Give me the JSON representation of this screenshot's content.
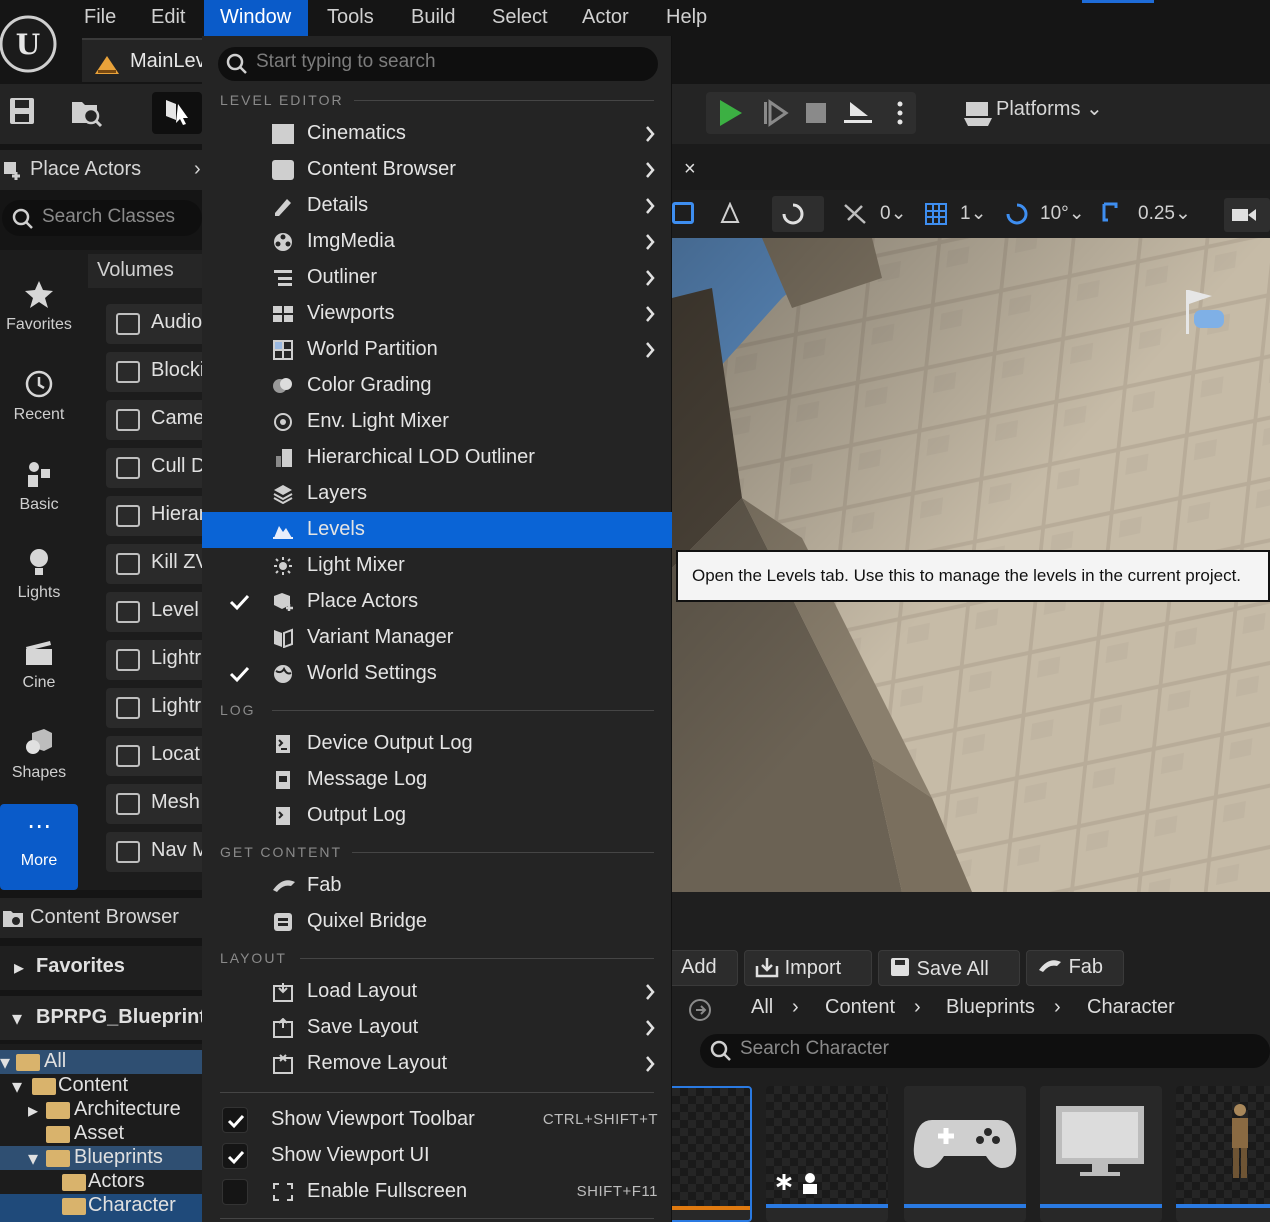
{
  "menu": {
    "items": [
      "File",
      "Edit",
      "Window",
      "Tools",
      "Build",
      "Select",
      "Actor",
      "Help"
    ],
    "active": "Window"
  },
  "level_tab": {
    "title": "MainLev"
  },
  "toolbar": {
    "platforms_label": "Platforms"
  },
  "place_actors": {
    "header": "Place Actors",
    "search_placeholder": "Search Classes",
    "categories": [
      "Favorites",
      "Recent",
      "Basic",
      "Lights",
      "Cine",
      "Shapes",
      "More"
    ],
    "section_title": "Volumes",
    "items": [
      "Audio",
      "Blocki",
      "Came",
      "Cull D",
      "Hierar",
      "Kill ZV",
      "Level",
      "Lightr",
      "Lightr",
      "Locat",
      "Mesh",
      "Nav M"
    ]
  },
  "content_browser_left": {
    "header": "Content Browser",
    "favorites": "Favorites",
    "project": "BPRPG_Blueprint",
    "tree": [
      "All",
      "Content",
      "Architecture",
      "Asset",
      "Blueprints",
      "Actors",
      "Character"
    ]
  },
  "viewport": {
    "snap_values": [
      "0",
      "1",
      "10°",
      "0.25"
    ],
    "close": "×",
    "tooltip": "Open the Levels tab. Use this to manage the levels in the current project."
  },
  "content_browser_right": {
    "buttons": [
      "Add",
      "Import",
      "Save All",
      "Fab"
    ],
    "breadcrumb": [
      "All",
      "Content",
      "Blueprints",
      "Character"
    ],
    "search_placeholder": "Search Character"
  },
  "window_menu": {
    "search_placeholder": "Start typing to search",
    "sections": {
      "level_editor": "LEVEL EDITOR",
      "log": "LOG",
      "get_content": "GET CONTENT",
      "layout": "LAYOUT"
    },
    "level_editor_items": [
      "Cinematics",
      "Content Browser",
      "Details",
      "ImgMedia",
      "Outliner",
      "Viewports",
      "World Partition",
      "Color Grading",
      "Env. Light Mixer",
      "Hierarchical LOD Outliner",
      "Layers",
      "Levels",
      "Light Mixer",
      "Place Actors",
      "Variant Manager",
      "World Settings"
    ],
    "log_items": [
      "Device Output Log",
      "Message Log",
      "Output Log"
    ],
    "get_content_items": [
      "Fab",
      "Quixel Bridge"
    ],
    "layout_items": [
      "Load Layout",
      "Save Layout",
      "Remove Layout"
    ],
    "toggles": [
      {
        "label": "Show Viewport Toolbar",
        "shortcut": "CTRL+SHIFT+T",
        "checked": true
      },
      {
        "label": "Show Viewport UI",
        "shortcut": "",
        "checked": true
      },
      {
        "label": "Enable Fullscreen",
        "shortcut": "SHIFT+F11",
        "checked": false
      }
    ],
    "highlighted": "Levels"
  },
  "colors": {
    "accent": "#0a64d6",
    "menu_bg": "#242424",
    "play_green": "#3cb043"
  }
}
